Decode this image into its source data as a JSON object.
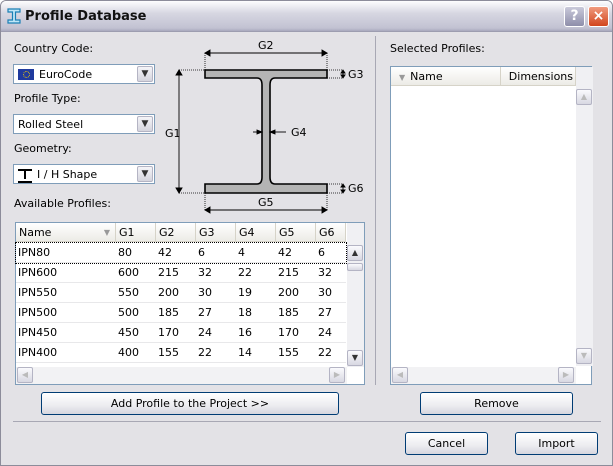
{
  "window": {
    "title": "Profile Database",
    "help": "?",
    "close": "×"
  },
  "left": {
    "country_label": "Country Code:",
    "country_value": "EuroCode",
    "type_label": "Profile Type:",
    "type_value": "Rolled Steel",
    "geometry_label": "Geometry:",
    "geometry_value": "I / H Shape",
    "available_label": "Available Profiles:"
  },
  "diagram": {
    "labels": [
      "G1",
      "G2",
      "G3",
      "G4",
      "G5",
      "G6"
    ]
  },
  "table": {
    "columns": [
      "Name",
      "G1",
      "G2",
      "G3",
      "G4",
      "G5",
      "G6"
    ],
    "rows": [
      [
        "IPN80",
        "80",
        "42",
        "6",
        "4",
        "42",
        "6"
      ],
      [
        "IPN600",
        "600",
        "215",
        "32",
        "22",
        "215",
        "32"
      ],
      [
        "IPN550",
        "550",
        "200",
        "30",
        "19",
        "200",
        "30"
      ],
      [
        "IPN500",
        "500",
        "185",
        "27",
        "18",
        "185",
        "27"
      ],
      [
        "IPN450",
        "450",
        "170",
        "24",
        "16",
        "170",
        "24"
      ],
      [
        "IPN400",
        "400",
        "155",
        "22",
        "14",
        "155",
        "22"
      ]
    ]
  },
  "right": {
    "selected_label": "Selected Profiles:",
    "columns": [
      "Name",
      "Dimensions"
    ]
  },
  "buttons": {
    "add": "Add Profile to the Project >>",
    "remove": "Remove",
    "cancel": "Cancel",
    "import": "Import"
  }
}
